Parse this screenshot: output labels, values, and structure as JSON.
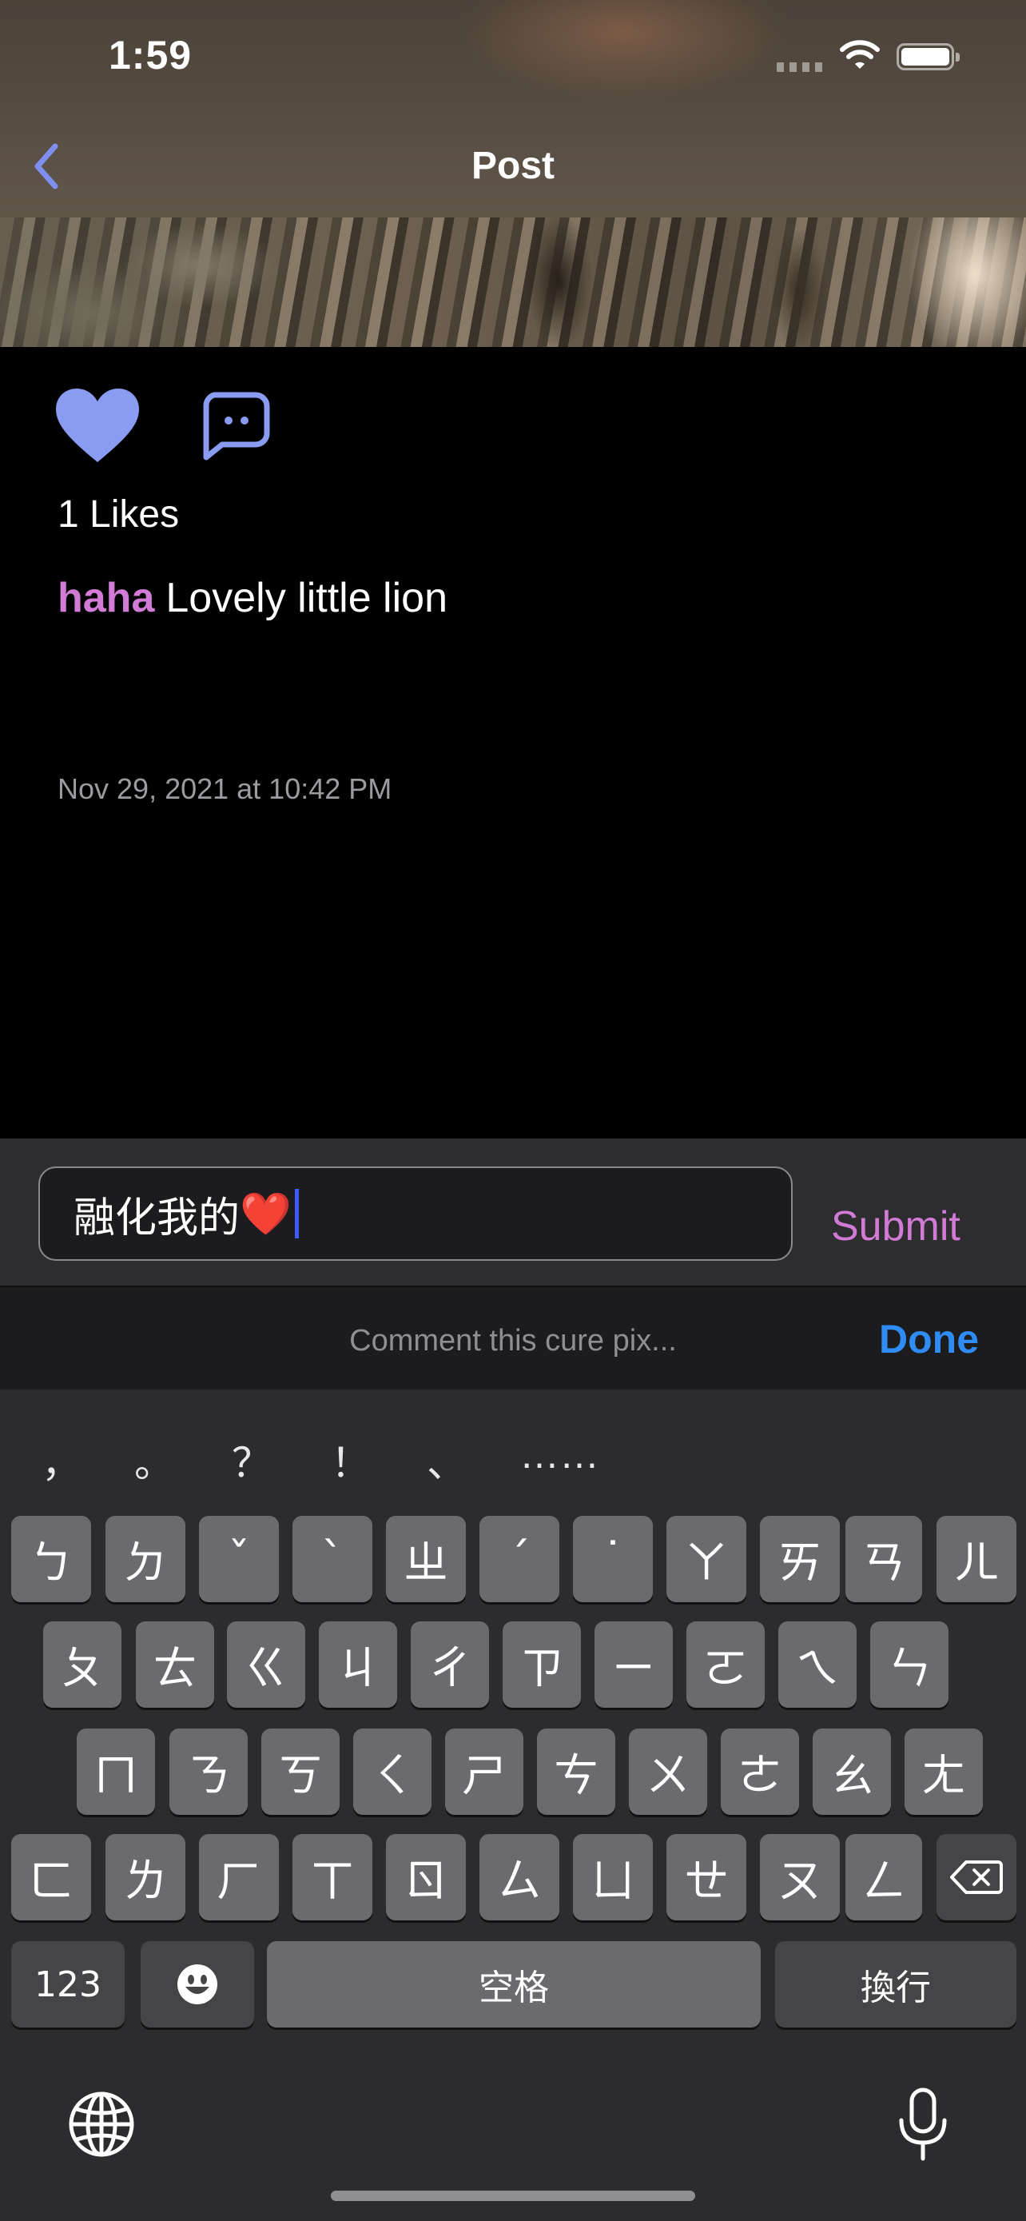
{
  "status_bar": {
    "time": "1:59"
  },
  "nav": {
    "title": "Post",
    "back_icon": "chevron-left-icon"
  },
  "post": {
    "likes_text": "1 Likes",
    "username": "haha",
    "caption": "Lovely little lion",
    "timestamp": "Nov 29, 2021 at 10:42 PM"
  },
  "comment_bar": {
    "input_value": "融化我的",
    "input_emoji": "❤️",
    "submit_label": "Submit"
  },
  "accessory": {
    "placeholder": "Comment this cure pix...",
    "done_label": "Done"
  },
  "keyboard": {
    "punctuation": [
      "，",
      "。",
      "？",
      "！",
      "、",
      "……"
    ],
    "row1": [
      "ㄅ",
      "ㄉ",
      "ˇ",
      "ˋ",
      "ㄓ",
      "ˊ",
      "˙",
      "ㄚ",
      "ㄞ",
      "ㄢ",
      "ㄦ"
    ],
    "row2": [
      "ㄆ",
      "ㄊ",
      "ㄍ",
      "ㄐ",
      "ㄔ",
      "ㄗ",
      "ㄧ",
      "ㄛ",
      "ㄟ",
      "ㄣ"
    ],
    "row3": [
      "ㄇ",
      "ㄋ",
      "ㄎ",
      "ㄑ",
      "ㄕ",
      "ㄘ",
      "ㄨ",
      "ㄜ",
      "ㄠ",
      "ㄤ"
    ],
    "row4": [
      "ㄈ",
      "ㄌ",
      "ㄏ",
      "ㄒ",
      "ㄖ",
      "ㄙ",
      "ㄩ",
      "ㄝ",
      "ㄡ",
      "ㄥ"
    ],
    "numbers_label": "123",
    "space_label": "空格",
    "return_label": "換行"
  },
  "colors": {
    "accent_like": "#8a9cf2",
    "username": "#d17bd6",
    "done": "#2f8cf5",
    "caret": "#3b5bff"
  }
}
